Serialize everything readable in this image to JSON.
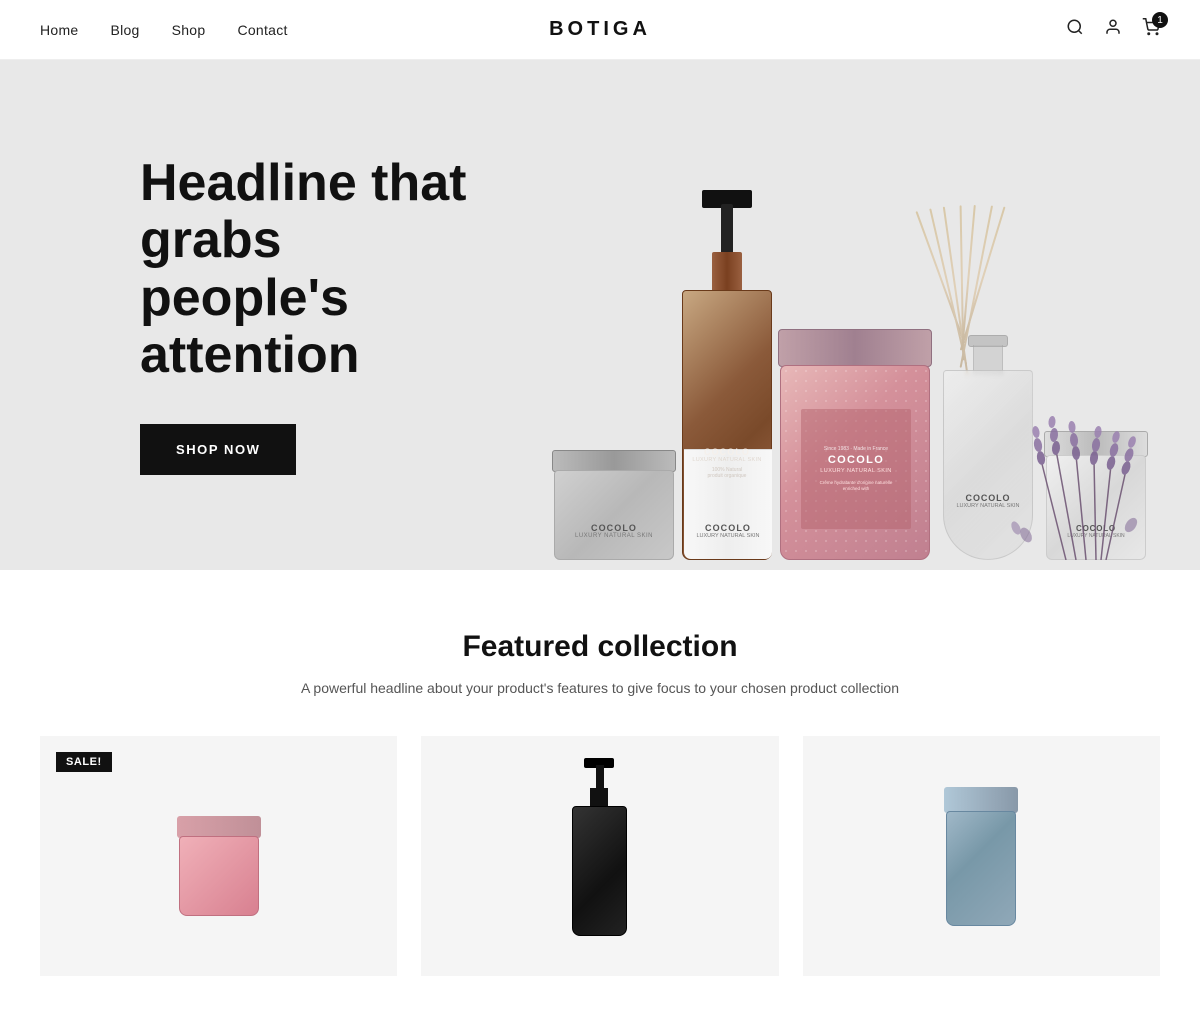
{
  "brand": {
    "name": "BOTIGA"
  },
  "nav": {
    "links": [
      {
        "id": "home",
        "label": "Home"
      },
      {
        "id": "blog",
        "label": "Blog"
      },
      {
        "id": "shop",
        "label": "Shop"
      },
      {
        "id": "contact",
        "label": "Contact"
      }
    ]
  },
  "cart": {
    "count": "1"
  },
  "hero": {
    "headline": "Headline that grabs people's attention",
    "cta_label": "SHOP NOW"
  },
  "featured": {
    "title": "Featured collection",
    "subtitle": "A powerful headline about your product's features to give focus to your chosen product collection",
    "sale_badge": "SALE!"
  },
  "products": {
    "cocolo": {
      "brand": "COCOLO",
      "sub": "LUXURY NATURAL SKIN",
      "desc": "100% Natural\nproduit organique",
      "since": "Since 1983\nMade in France"
    }
  },
  "icons": {
    "search": "🔍",
    "user": "👤",
    "cart": "🛒"
  }
}
